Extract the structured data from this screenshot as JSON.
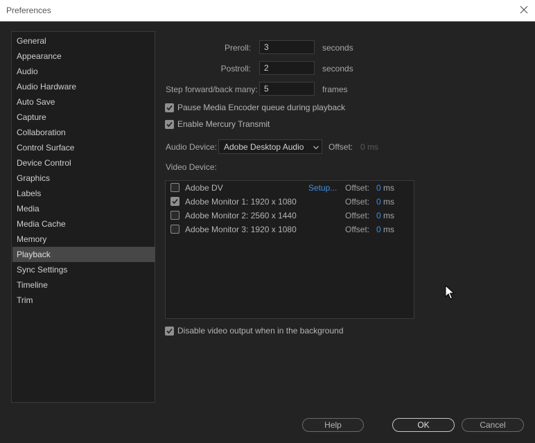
{
  "window": {
    "title": "Preferences"
  },
  "sidebar": {
    "items": [
      {
        "label": "General"
      },
      {
        "label": "Appearance"
      },
      {
        "label": "Audio"
      },
      {
        "label": "Audio Hardware"
      },
      {
        "label": "Auto Save"
      },
      {
        "label": "Capture"
      },
      {
        "label": "Collaboration"
      },
      {
        "label": "Control Surface"
      },
      {
        "label": "Device Control"
      },
      {
        "label": "Graphics"
      },
      {
        "label": "Labels"
      },
      {
        "label": "Media"
      },
      {
        "label": "Media Cache"
      },
      {
        "label": "Memory"
      },
      {
        "label": "Playback"
      },
      {
        "label": "Sync Settings"
      },
      {
        "label": "Timeline"
      },
      {
        "label": "Trim"
      }
    ],
    "selected": "Playback"
  },
  "playback": {
    "preroll": {
      "label": "Preroll:",
      "value": "3",
      "unit": "seconds"
    },
    "postroll": {
      "label": "Postroll:",
      "value": "2",
      "unit": "seconds"
    },
    "step": {
      "label": "Step forward/back many:",
      "value": "5",
      "unit": "frames"
    },
    "pause_encoder": {
      "label": "Pause Media Encoder queue during playback",
      "checked": true
    },
    "mercury": {
      "label": "Enable Mercury Transmit",
      "checked": true
    },
    "audio_device": {
      "label": "Audio Device:",
      "value": "Adobe Desktop Audio",
      "offset_label": "Offset:",
      "offset_value": "0 ms"
    },
    "video_device": {
      "label": "Video Device:"
    },
    "devices": [
      {
        "name": "Adobe DV",
        "checked": false,
        "setup": "Setup...",
        "offset_label": "Offset:",
        "offset": "0",
        "unit": "ms"
      },
      {
        "name": "Adobe Monitor 1: 1920 x 1080",
        "checked": true,
        "offset_label": "Offset:",
        "offset": "0",
        "unit": "ms"
      },
      {
        "name": "Adobe Monitor 2: 2560 x 1440",
        "checked": false,
        "offset_label": "Offset:",
        "offset": "0",
        "unit": "ms"
      },
      {
        "name": "Adobe Monitor 3: 1920 x 1080",
        "checked": false,
        "offset_label": "Offset:",
        "offset": "0",
        "unit": "ms"
      }
    ],
    "disable_bg": {
      "label": "Disable video output when in the background",
      "checked": true
    }
  },
  "buttons": {
    "help": "Help",
    "ok": "OK",
    "cancel": "Cancel"
  },
  "colors": {
    "accent": "#3f8ee0",
    "background": "#232323",
    "selected": "#474747"
  },
  "icons": {
    "close": "close-icon",
    "checkbox": "checkmark-icon",
    "dropdown": "chevron-down-icon",
    "cursor": "mouse-cursor-icon"
  }
}
